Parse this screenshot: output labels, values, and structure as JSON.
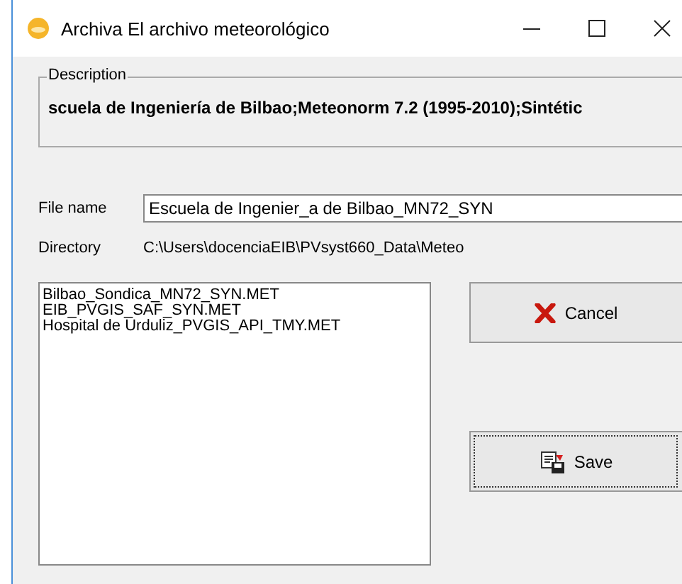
{
  "window": {
    "title": "Archiva El archivo meteorológico"
  },
  "description": {
    "label": "Description",
    "text": "scuela de Ingeniería de Bilbao;Meteonorm 7.2 (1995-2010);Sintétic"
  },
  "file_name": {
    "label": "File name",
    "value": "Escuela de Ingenier_a de Bilbao_MN72_SYN"
  },
  "directory": {
    "label": "Directory",
    "value": "C:\\Users\\docenciaEIB\\PVsyst660_Data\\Meteo"
  },
  "files": [
    "Bilbao_Sondica_MN72_SYN.MET",
    "EIB_PVGIS_SAF_SYN.MET",
    "Hospital de Urduliz_PVGIS_API_TMY.MET"
  ],
  "buttons": [
    {
      "kind": "cancel",
      "label": "Cancel",
      "focused": false
    },
    {
      "kind": "save",
      "label": "Save",
      "focused": true
    }
  ]
}
